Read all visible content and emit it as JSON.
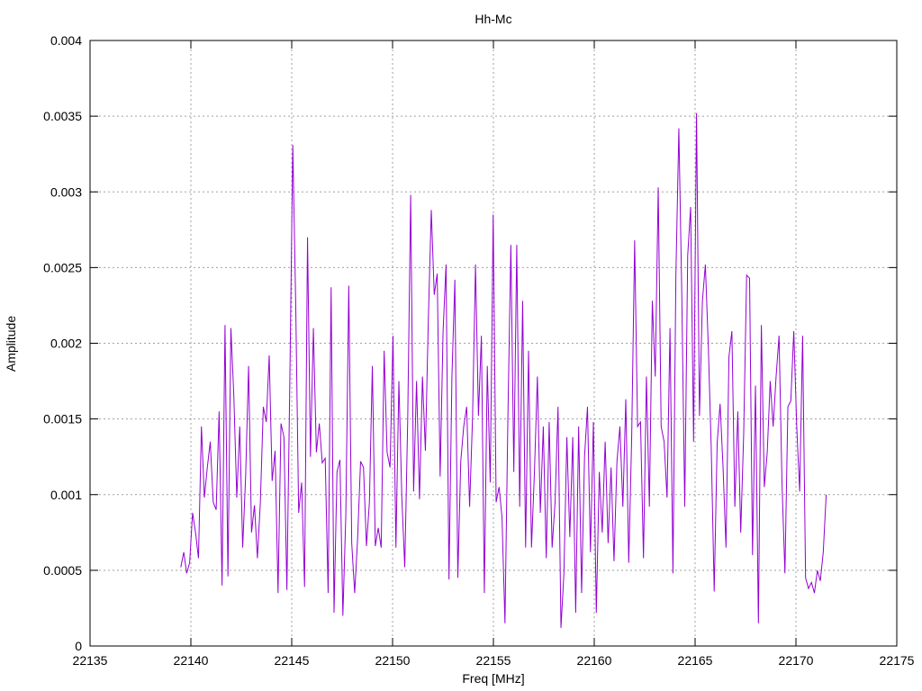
{
  "chart_data": {
    "type": "line",
    "title": "Hh-Mc",
    "xlabel": "Freq [MHz]",
    "ylabel": "Amplitude",
    "xlim": [
      22135,
      22175
    ],
    "ylim": [
      0,
      0.004
    ],
    "xticks": [
      22135,
      22140,
      22145,
      22150,
      22155,
      22160,
      22165,
      22170,
      22175
    ],
    "yticks": [
      0,
      0.0005,
      0.001,
      0.0015,
      0.002,
      0.0025,
      0.003,
      0.0035,
      0.004
    ],
    "xtick_labels": [
      "22135",
      "22140",
      "22145",
      "22150",
      "22155",
      "22160",
      "22165",
      "22170",
      "22175"
    ],
    "ytick_labels": [
      "0",
      "0.0005",
      "0.001",
      "0.0015",
      "0.002",
      "0.0025",
      "0.003",
      "0.0035",
      "0.004"
    ],
    "grid": true,
    "line_color": "#9400d3",
    "x_start": 22139.5,
    "x_end": 22171.5,
    "series": [
      {
        "values": [
          0.00052,
          0.00062,
          0.00048,
          0.00055,
          0.00088,
          0.00075,
          0.00058,
          0.00145,
          0.00098,
          0.00118,
          0.00135,
          0.00095,
          0.0009,
          0.00155,
          0.0004,
          0.00212,
          0.00046,
          0.0021,
          0.00165,
          0.00098,
          0.00145,
          0.00065,
          0.00112,
          0.00185,
          0.00075,
          0.00093,
          0.00058,
          0.00095,
          0.00158,
          0.00148,
          0.00192,
          0.00109,
          0.00129,
          0.00035,
          0.00147,
          0.00138,
          0.00037,
          0.00175,
          0.00331,
          0.00225,
          0.00088,
          0.00108,
          0.00039,
          0.0027,
          0.00125,
          0.0021,
          0.00128,
          0.00147,
          0.00121,
          0.00124,
          0.00035,
          0.00237,
          0.00022,
          0.00115,
          0.00123,
          0.0002,
          0.00087,
          0.00238,
          0.00068,
          0.00035,
          0.00071,
          0.00122,
          0.00118,
          0.00066,
          0.00095,
          0.00185,
          0.00066,
          0.00078,
          0.00065,
          0.00195,
          0.00128,
          0.00118,
          0.00205,
          0.00065,
          0.00175,
          0.00098,
          0.00052,
          0.0015,
          0.00298,
          0.00102,
          0.00175,
          0.00097,
          0.00178,
          0.00129,
          0.00216,
          0.00288,
          0.00232,
          0.00246,
          0.00112,
          0.00208,
          0.00252,
          0.00044,
          0.00178,
          0.00242,
          0.00045,
          0.00122,
          0.00145,
          0.00158,
          0.00092,
          0.00151,
          0.00252,
          0.00152,
          0.00205,
          0.00035,
          0.00185,
          0.00108,
          0.00285,
          0.00095,
          0.00105,
          0.00085,
          0.00015,
          0.00152,
          0.00265,
          0.00115,
          0.00265,
          0.00092,
          0.00228,
          0.00065,
          0.00195,
          0.00065,
          0.00115,
          0.00178,
          0.00088,
          0.00145,
          0.00058,
          0.00148,
          0.00065,
          0.00095,
          0.00158,
          0.00012,
          0.00048,
          0.00138,
          0.00072,
          0.00138,
          0.00022,
          0.00145,
          0.00035,
          0.00125,
          0.00158,
          0.00062,
          0.00148,
          0.00022,
          0.00115,
          0.00075,
          0.00135,
          0.00068,
          0.00118,
          0.00056,
          0.00122,
          0.00145,
          0.00092,
          0.00163,
          0.00055,
          0.00138,
          0.00268,
          0.00145,
          0.00148,
          0.00058,
          0.00178,
          0.00092,
          0.00228,
          0.00178,
          0.00303,
          0.00145,
          0.00135,
          0.00098,
          0.0021,
          0.00048,
          0.00245,
          0.00342,
          0.00232,
          0.00092,
          0.00258,
          0.0029,
          0.00135,
          0.00352,
          0.00152,
          0.00228,
          0.00252,
          0.00198,
          0.0013,
          0.00036,
          0.00134,
          0.0016,
          0.00118,
          0.00065,
          0.00191,
          0.00208,
          0.00092,
          0.00155,
          0.00075,
          0.0014,
          0.00245,
          0.00243,
          0.0006,
          0.00172,
          0.00015,
          0.00212,
          0.00105,
          0.00128,
          0.00175,
          0.00145,
          0.00178,
          0.00205,
          0.00108,
          0.00048,
          0.00158,
          0.00162,
          0.00208,
          0.00145,
          0.00102,
          0.00205,
          0.00045,
          0.00038,
          0.00042,
          0.00035,
          0.0005,
          0.00043,
          0.00062,
          0.001
        ]
      }
    ]
  }
}
